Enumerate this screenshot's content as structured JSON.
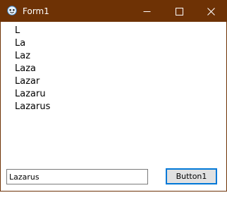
{
  "window": {
    "title": "Form1",
    "titlebar_color": "#6e3205",
    "icon": "app-icon"
  },
  "controls": {
    "minimize_icon": "minimize-icon",
    "maximize_icon": "maximize-icon",
    "close_icon": "close-icon"
  },
  "output_lines": [
    "L",
    "La",
    "Laz",
    "Laza",
    "Lazar",
    "Lazaru",
    "Lazarus"
  ],
  "textbox": {
    "value": "Lazarus"
  },
  "button": {
    "label": "Button1",
    "focus_color": "#0078d7"
  }
}
